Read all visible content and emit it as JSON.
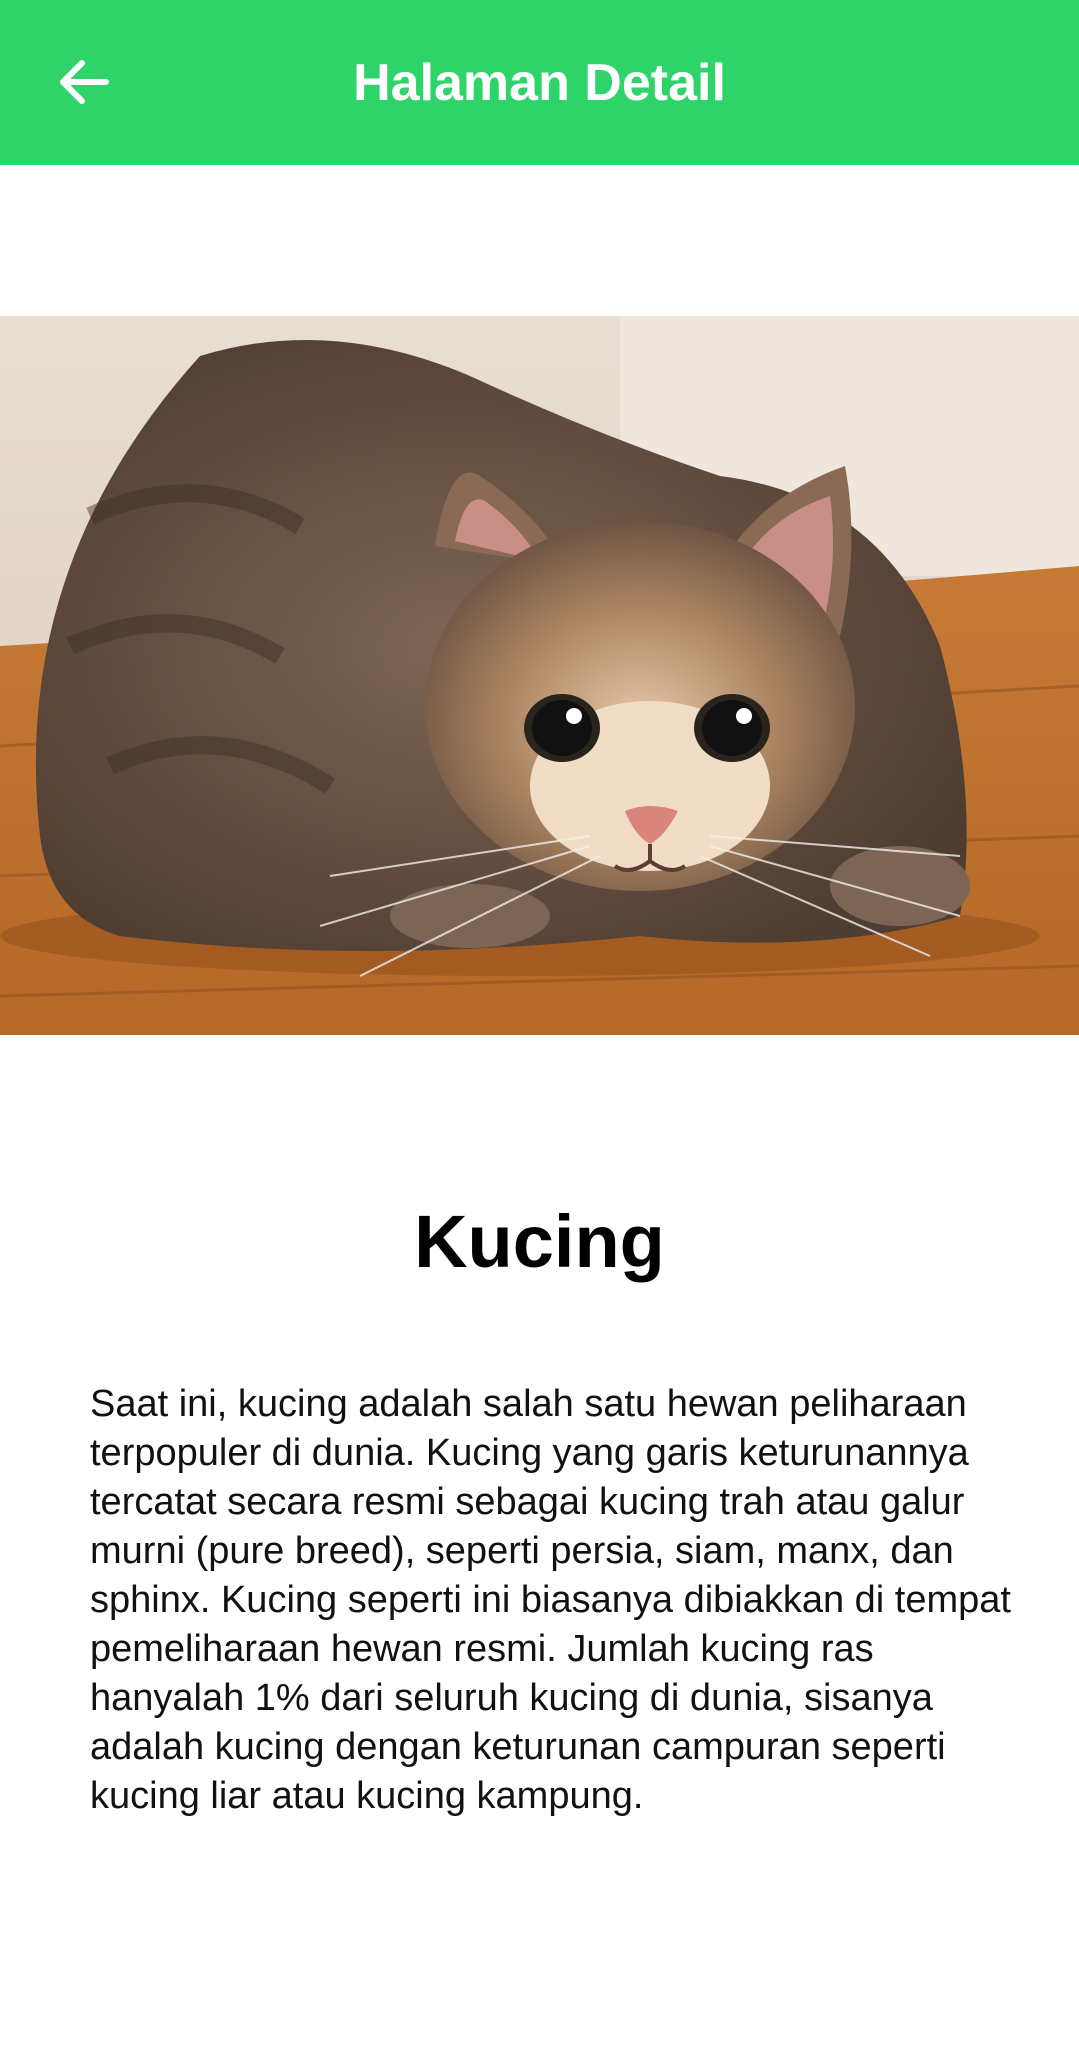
{
  "app_bar": {
    "title": "Halaman Detail",
    "back_icon": "arrow-left-icon",
    "color": "#2ed46a"
  },
  "detail": {
    "image_alt": "cat-photo",
    "name": "Kucing",
    "description": "Saat ini, kucing adalah salah satu hewan peliharaan terpopuler di dunia. Kucing yang garis keturunannya tercatat secara resmi sebagai kucing trah atau galur murni (pure breed), seperti persia, siam, manx, dan sphinx. Kucing seperti ini biasanya dibiakkan di tempat pemeliharaan hewan resmi. Jumlah kucing ras hanyalah 1% dari seluruh kucing di dunia, sisanya adalah kucing dengan keturunan campuran seperti kucing liar atau kucing kampung."
  }
}
